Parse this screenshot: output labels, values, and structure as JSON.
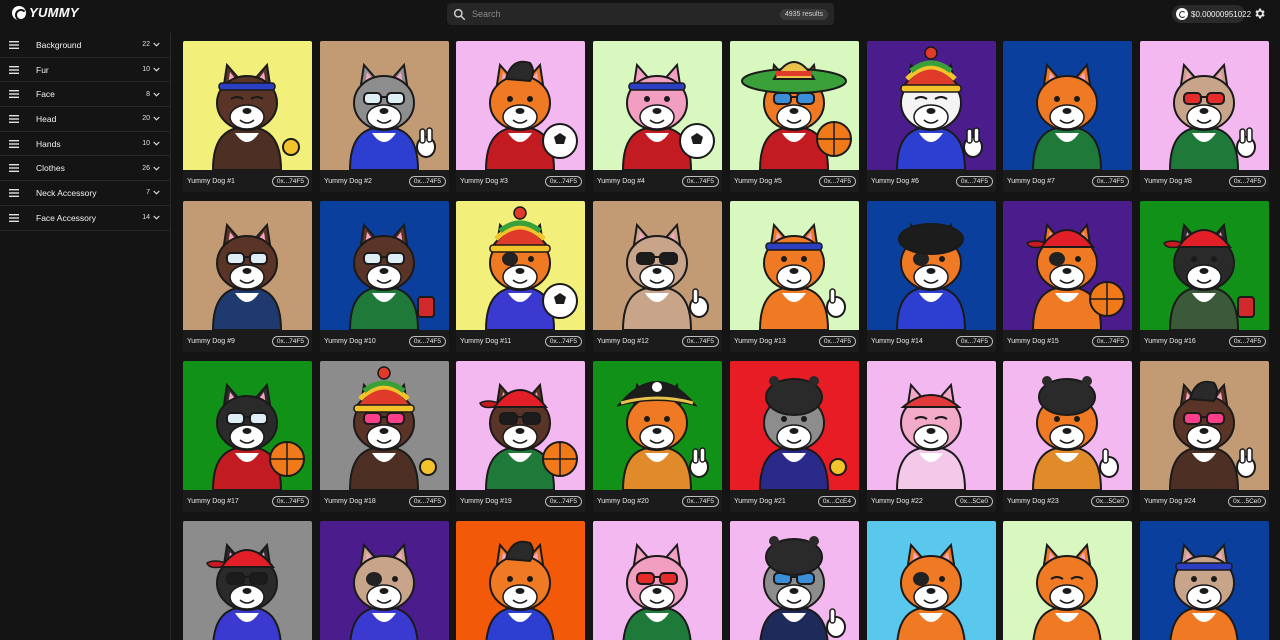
{
  "header": {
    "logo_text": "YUMMY",
    "search_placeholder": "Search",
    "results": "4935 results",
    "wallet_balance": "$0.00000951022"
  },
  "filters": [
    {
      "label": "Background",
      "count": "22"
    },
    {
      "label": "Fur",
      "count": "10"
    },
    {
      "label": "Face",
      "count": "8"
    },
    {
      "label": "Head",
      "count": "20"
    },
    {
      "label": "Hands",
      "count": "10"
    },
    {
      "label": "Clothes",
      "count": "26"
    },
    {
      "label": "Neck Accessory",
      "count": "7"
    },
    {
      "label": "Face Accessory",
      "count": "14"
    }
  ],
  "items": [
    {
      "name": "Yummy Dog #1",
      "address": "0x...74F5",
      "bg": "#f2f07a",
      "fur": "#5a3426",
      "shirt": "#4e2f24",
      "hat": "band-blue",
      "eyes": "closed",
      "hand": "coin"
    },
    {
      "name": "Yummy Dog #2",
      "address": "0x...74F5",
      "bg": "#c29a74",
      "fur": "#8d8d8d",
      "shirt": "#2d3fd1",
      "hat": "none",
      "eyes": "glasses-clear",
      "hand": "peace"
    },
    {
      "name": "Yummy Dog #3",
      "address": "0x...74F5",
      "bg": "#f4b8f0",
      "fur": "#f07a24",
      "shirt": "#c31b22",
      "hat": "pompadour",
      "eyes": "open",
      "hand": "soccer"
    },
    {
      "name": "Yummy Dog #4",
      "address": "0x...74F5",
      "bg": "#d8f8c0",
      "fur": "#f29ec0",
      "shirt": "#c31b22",
      "hat": "band-blue",
      "eyes": "open",
      "hand": "soccer"
    },
    {
      "name": "Yummy Dog #5",
      "address": "0x...74F5",
      "bg": "#d8f8c0",
      "fur": "#f07a24",
      "shirt": "#c31b22",
      "hat": "sombrero",
      "eyes": "goggles",
      "hand": "basketball"
    },
    {
      "name": "Yummy Dog #6",
      "address": "0x...74F5",
      "bg": "#4a1c8c",
      "fur": "#f4f4f4",
      "shirt": "#2d3fd1",
      "hat": "beanie",
      "eyes": "closed",
      "hand": "peace"
    },
    {
      "name": "Yummy Dog #7",
      "address": "0x...74F5",
      "bg": "#0a3f9e",
      "fur": "#f07a24",
      "shirt": "#1f7a3a",
      "hat": "none",
      "eyes": "open",
      "hand": "none"
    },
    {
      "name": "Yummy Dog #8",
      "address": "0x...74F5",
      "bg": "#f4b8f0",
      "fur": "#c8a58a",
      "shirt": "#1f7a3a",
      "hat": "none",
      "eyes": "glasses-red",
      "hand": "peace"
    },
    {
      "name": "Yummy Dog #9",
      "address": "0x...74F5",
      "bg": "#c29a74",
      "fur": "#5a3426",
      "shirt": "#1e3a6e",
      "hat": "none",
      "eyes": "glasses-clear",
      "hand": "none"
    },
    {
      "name": "Yummy Dog #10",
      "address": "0x...74F5",
      "bg": "#0a3f9e",
      "fur": "#5a3426",
      "shirt": "#1f7a3a",
      "hat": "none",
      "eyes": "glasses-round",
      "hand": "cup"
    },
    {
      "name": "Yummy Dog #11",
      "address": "0x...74F5",
      "bg": "#f2f07a",
      "fur": "#f07a24",
      "shirt": "#3a3ad1",
      "hat": "beanie",
      "eyes": "patch",
      "hand": "soccer"
    },
    {
      "name": "Yummy Dog #12",
      "address": "0x...74F5",
      "bg": "#c29a74",
      "fur": "#c8a58a",
      "shirt": "#c8a58a",
      "hat": "none",
      "eyes": "glasses-dark",
      "hand": "thumb"
    },
    {
      "name": "Yummy Dog #13",
      "address": "0x...74F5",
      "bg": "#d8f8c0",
      "fur": "#f07a24",
      "shirt": "#f07a24",
      "hat": "band-blue",
      "eyes": "open",
      "hand": "thumb"
    },
    {
      "name": "Yummy Dog #14",
      "address": "0x...74F5",
      "bg": "#0a3f9e",
      "fur": "#f07a24",
      "shirt": "#2d3fd1",
      "hat": "beret",
      "eyes": "patch",
      "hand": "none"
    },
    {
      "name": "Yummy Dog #15",
      "address": "0x...74F5",
      "bg": "#4a1c8c",
      "fur": "#f07a24",
      "shirt": "#f07a24",
      "hat": "cap-red",
      "eyes": "patch",
      "hand": "basketball"
    },
    {
      "name": "Yummy Dog #16",
      "address": "0x...74F5",
      "bg": "#129118",
      "fur": "#2a2a2a",
      "shirt": "#3a5a3a",
      "hat": "cap-red",
      "eyes": "open",
      "hand": "cup"
    },
    {
      "name": "Yummy Dog #17",
      "address": "0x...74F5",
      "bg": "#129118",
      "fur": "#2a2a2a",
      "shirt": "#c31b22",
      "hat": "none",
      "eyes": "glasses-clear",
      "hand": "basketball"
    },
    {
      "name": "Yummy Dog #18",
      "address": "0x...74F5",
      "bg": "#8c8c8c",
      "fur": "#5a3426",
      "shirt": "#4e2f24",
      "hat": "beanie",
      "eyes": "heart",
      "hand": "coin"
    },
    {
      "name": "Yummy Dog #19",
      "address": "0x...74F5",
      "bg": "#f4b8f0",
      "fur": "#5a3426",
      "shirt": "#1f7a3a",
      "hat": "cap-red",
      "eyes": "glasses-dark",
      "hand": "basketball"
    },
    {
      "name": "Yummy Dog #20",
      "address": "0x...74F5",
      "bg": "#129118",
      "fur": "#f07a24",
      "shirt": "#e08a2a",
      "hat": "pirate",
      "eyes": "open",
      "hand": "wave"
    },
    {
      "name": "Yummy Dog #21",
      "address": "0x...CcE4",
      "bg": "#e81c24",
      "fur": "#8d8d8d",
      "shirt": "#2a2a8a",
      "hat": "hippo",
      "eyes": "open",
      "hand": "coin"
    },
    {
      "name": "Yummy Dog #22",
      "address": "0x...5Ce0",
      "bg": "#f4b8f0",
      "fur": "#f2aac8",
      "shirt": "#f4c8e8",
      "hat": "bandana",
      "eyes": "closed",
      "hand": "none"
    },
    {
      "name": "Yummy Dog #23",
      "address": "0x...5Ce0",
      "bg": "#f4b8f0",
      "fur": "#f07a24",
      "shirt": "#e08a2a",
      "hat": "hippo",
      "eyes": "open",
      "hand": "thumb"
    },
    {
      "name": "Yummy Dog #24",
      "address": "0x...5Ce0",
      "bg": "#c29a74",
      "fur": "#5a3426",
      "shirt": "#4e2f24",
      "hat": "pompadour",
      "eyes": "heart",
      "hand": "wave"
    },
    {
      "name": "",
      "address": "",
      "bg": "#8c8c8c",
      "fur": "#2a2a2a",
      "shirt": "#3a3ad1",
      "hat": "cap-red",
      "eyes": "glasses-dark",
      "hand": "none"
    },
    {
      "name": "",
      "address": "",
      "bg": "#4a1c8c",
      "fur": "#c8a58a",
      "shirt": "#3a3ad1",
      "hat": "none",
      "eyes": "patch",
      "hand": "none"
    },
    {
      "name": "",
      "address": "",
      "bg": "#f25a0a",
      "fur": "#f07a24",
      "shirt": "#2d3fd1",
      "hat": "pompadour",
      "eyes": "open",
      "hand": "none"
    },
    {
      "name": "",
      "address": "",
      "bg": "#f4b8f0",
      "fur": "#f29ec0",
      "shirt": "#1f7a3a",
      "hat": "none",
      "eyes": "glasses-red",
      "hand": "none"
    },
    {
      "name": "",
      "address": "",
      "bg": "#f4b8f0",
      "fur": "#8d8d8d",
      "shirt": "#1e2a5a",
      "hat": "hippo",
      "eyes": "goggles",
      "hand": "thumb"
    },
    {
      "name": "",
      "address": "",
      "bg": "#5ac8ec",
      "fur": "#f07a24",
      "shirt": "#f07a24",
      "hat": "none",
      "eyes": "patch",
      "hand": "none"
    },
    {
      "name": "",
      "address": "",
      "bg": "#d8f8c0",
      "fur": "#f07a24",
      "shirt": "#f07a24",
      "hat": "none",
      "eyes": "closed",
      "hand": "none"
    },
    {
      "name": "",
      "address": "",
      "bg": "#0a3f9e",
      "fur": "#c8a58a",
      "shirt": "#f07a24",
      "hat": "band-blue",
      "eyes": "open",
      "hand": "none"
    }
  ]
}
